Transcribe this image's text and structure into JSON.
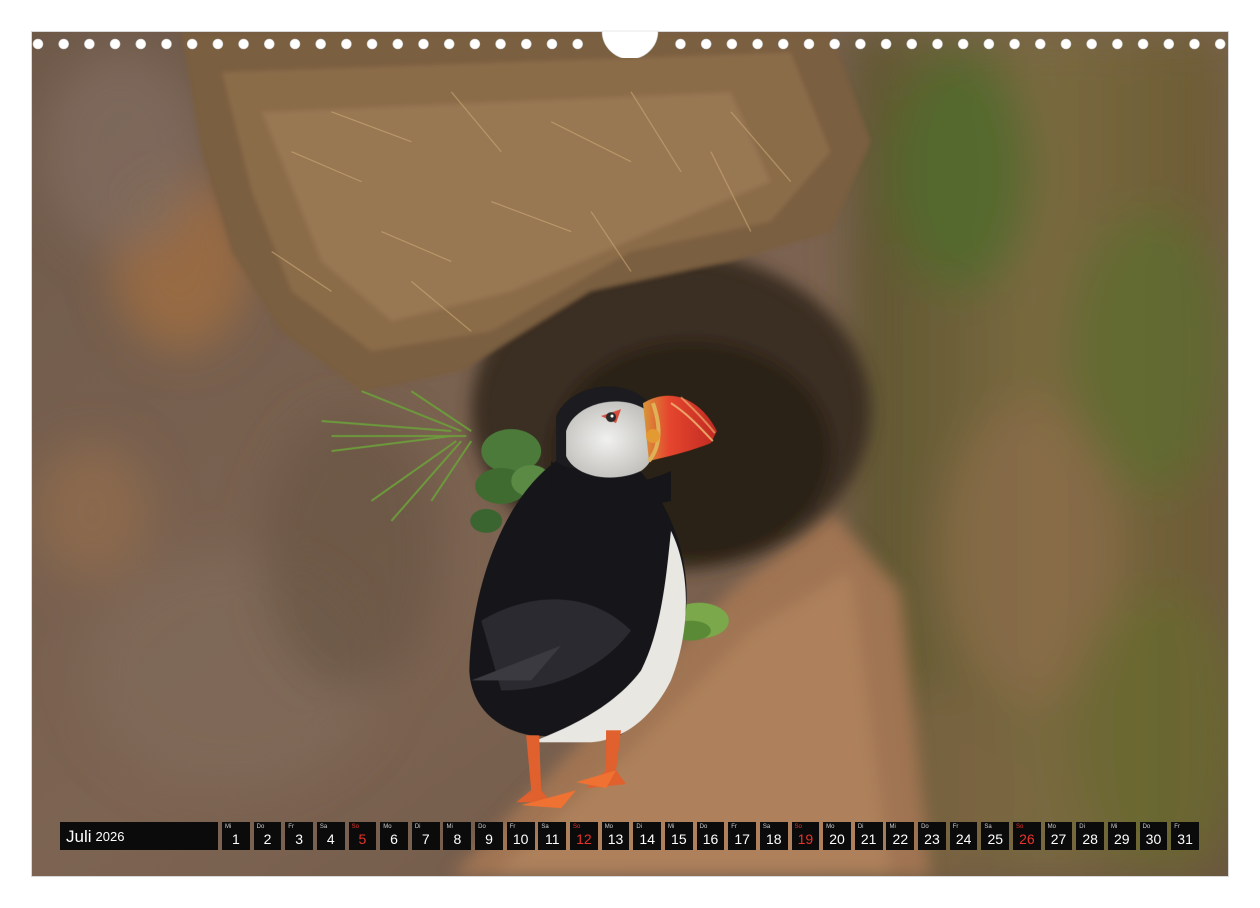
{
  "calendar": {
    "month": "Juli",
    "year": "2026",
    "days": [
      {
        "dow": "Mi",
        "num": "1"
      },
      {
        "dow": "Do",
        "num": "2"
      },
      {
        "dow": "Fr",
        "num": "3"
      },
      {
        "dow": "Sa",
        "num": "4"
      },
      {
        "dow": "So",
        "num": "5",
        "sunday": true
      },
      {
        "dow": "Mo",
        "num": "6"
      },
      {
        "dow": "Di",
        "num": "7"
      },
      {
        "dow": "Mi",
        "num": "8"
      },
      {
        "dow": "Do",
        "num": "9"
      },
      {
        "dow": "Fr",
        "num": "10"
      },
      {
        "dow": "Sa",
        "num": "11"
      },
      {
        "dow": "So",
        "num": "12",
        "sunday": true
      },
      {
        "dow": "Mo",
        "num": "13"
      },
      {
        "dow": "Di",
        "num": "14"
      },
      {
        "dow": "Mi",
        "num": "15"
      },
      {
        "dow": "Do",
        "num": "16"
      },
      {
        "dow": "Fr",
        "num": "17"
      },
      {
        "dow": "Sa",
        "num": "18"
      },
      {
        "dow": "So",
        "num": "19",
        "sunday": true
      },
      {
        "dow": "Mo",
        "num": "20"
      },
      {
        "dow": "Di",
        "num": "21"
      },
      {
        "dow": "Mi",
        "num": "22"
      },
      {
        "dow": "Do",
        "num": "23"
      },
      {
        "dow": "Fr",
        "num": "24"
      },
      {
        "dow": "Sa",
        "num": "25"
      },
      {
        "dow": "So",
        "num": "26",
        "sunday": true
      },
      {
        "dow": "Mo",
        "num": "27"
      },
      {
        "dow": "Di",
        "num": "28"
      },
      {
        "dow": "Mi",
        "num": "29"
      },
      {
        "dow": "Do",
        "num": "30"
      },
      {
        "dow": "Fr",
        "num": "31"
      }
    ]
  },
  "colors": {
    "bar_background": "#0b0b0b",
    "day_text": "#ffffff",
    "sunday_text": "#e8332a"
  }
}
